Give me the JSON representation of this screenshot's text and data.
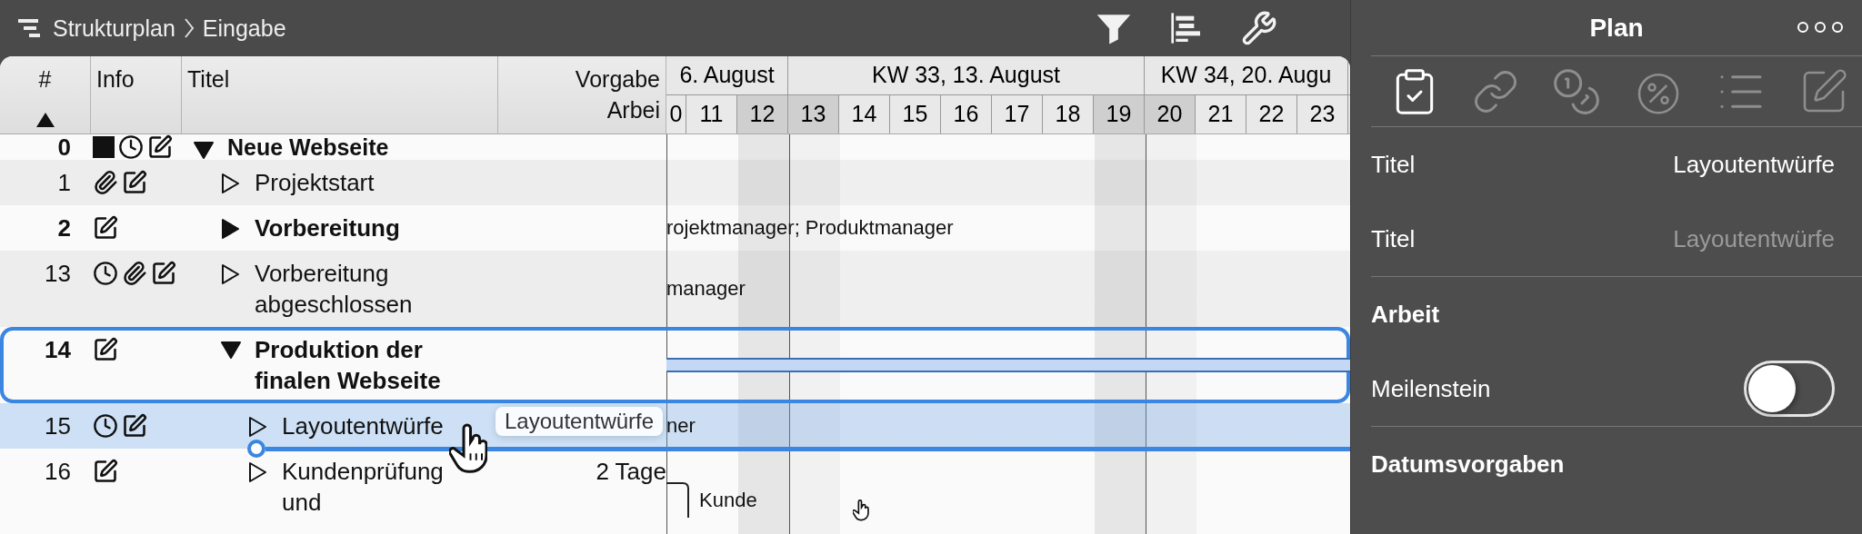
{
  "breadcrumb": {
    "items": [
      "Strukturplan",
      "Eingabe"
    ]
  },
  "table": {
    "columns": [
      {
        "lines": [
          "#"
        ],
        "sort_ascending": true
      },
      {
        "lines": [
          "Info"
        ],
        "sort_ascending": false
      },
      {
        "lines": [
          "Titel"
        ],
        "sort_ascending": false
      },
      {
        "lines": [
          "Vorgabe",
          "Arbei"
        ],
        "sort_ascending": false
      }
    ],
    "timeline": {
      "weeks": [
        {
          "label": "6. August",
          "days": [
            {
              "label": "0",
              "kind": "workday"
            },
            {
              "label": "11",
              "kind": "workday"
            },
            {
              "label": "12",
              "kind": "weekend"
            }
          ]
        },
        {
          "label": "KW 33, 13. August",
          "days": [
            {
              "label": "13",
              "kind": "week_start"
            },
            {
              "label": "14",
              "kind": "workday"
            },
            {
              "label": "15",
              "kind": "workday"
            },
            {
              "label": "16",
              "kind": "workday"
            },
            {
              "label": "17",
              "kind": "workday"
            },
            {
              "label": "18",
              "kind": "workday"
            },
            {
              "label": "19",
              "kind": "weekend"
            }
          ]
        },
        {
          "label": "KW 34, 20. Augu",
          "days": [
            {
              "label": "20",
              "kind": "week_start"
            },
            {
              "label": "21",
              "kind": "workday"
            },
            {
              "label": "22",
              "kind": "workday"
            },
            {
              "label": "23",
              "kind": "workday"
            }
          ]
        }
      ]
    },
    "tasks": [
      {
        "number": "0",
        "title": "Neue Webseite",
        "kind": "group",
        "expanded": true,
        "selected": false,
        "drop_target": false,
        "indicators": [
          {
            "kind": "square"
          },
          {
            "kind": "clock"
          },
          {
            "kind": "note"
          }
        ],
        "children": [
          {
            "number": "1",
            "title": "Projektstart",
            "kind": "task",
            "expanded": false,
            "selected": false,
            "drop_target": false,
            "indicators": [
              {
                "kind": "clip"
              },
              {
                "kind": "note"
              }
            ]
          },
          {
            "number": "2",
            "title": "Vorbereitung",
            "kind": "group",
            "expanded": false,
            "selected": false,
            "drop_target": false,
            "indicators": [
              {
                "kind": "note"
              }
            ],
            "gantt": {
              "kind": "text",
              "label": "rojektmanager; Produktmanager"
            }
          },
          {
            "number": "13",
            "title": "Vorbereitung abgeschlossen",
            "kind": "task",
            "expanded": false,
            "selected": false,
            "drop_target": false,
            "indicators": [
              {
                "kind": "clock"
              },
              {
                "kind": "clip"
              },
              {
                "kind": "note"
              }
            ],
            "gantt": {
              "kind": "text",
              "label": "manager"
            }
          },
          {
            "number": "14",
            "title": "Produktion der finalen Webseite",
            "kind": "group",
            "expanded": true,
            "selected": true,
            "drop_target": false,
            "indicators": [
              {
                "kind": "note"
              }
            ],
            "gantt": {
              "kind": "bar"
            },
            "children": [
              {
                "number": "15",
                "title": "Layoutentwürfe",
                "kind": "task",
                "expanded": false,
                "selected": false,
                "drop_target": true,
                "indicators": [
                  {
                    "kind": "clock"
                  },
                  {
                    "kind": "note"
                  }
                ],
                "gantt": {
                  "kind": "text",
                  "label": "ner"
                }
              },
              {
                "number": "16",
                "title": "Kundenprüfung und",
                "kind": "task",
                "expanded": false,
                "selected": false,
                "drop_target": false,
                "indicators": [
                  {
                    "kind": "note"
                  }
                ],
                "work": "2 Tage",
                "gantt": {
                  "kind": "linked",
                  "label": "Kunde"
                }
              }
            ]
          }
        ]
      }
    ]
  },
  "drag": {
    "label": "Layoutentwürfe"
  },
  "inspector": {
    "title": "Plan",
    "tabs": [
      {
        "selected": true
      },
      {
        "selected": false
      },
      {
        "selected": false
      },
      {
        "selected": false
      },
      {
        "selected": false
      },
      {
        "selected": false
      }
    ],
    "fields": [
      {
        "label": "Titel",
        "value": "Layoutentwürfe"
      },
      {
        "label": "Titel",
        "placeholder": "Layoutentwürfe"
      }
    ],
    "sections": [
      {
        "heading": "Arbeit",
        "rows": [
          {
            "kind": "toggle",
            "label": "Meilenstein",
            "on": false
          }
        ]
      },
      {
        "heading": "Datumsvorgaben"
      }
    ]
  }
}
